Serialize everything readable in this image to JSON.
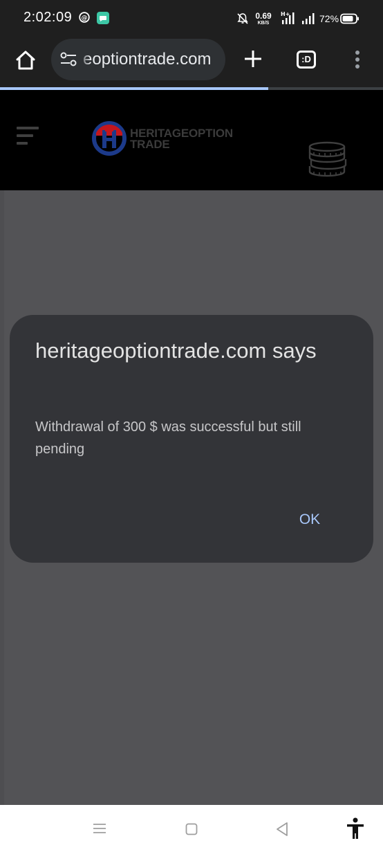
{
  "status_bar": {
    "time": "2:02:09",
    "net_speed_value": "0.69",
    "net_speed_unit": "KB/S",
    "network_type": "H+",
    "battery_percent": "72%",
    "icons": [
      "threads-icon",
      "app-notification-icon",
      "mute-bell-icon",
      "signal-icon",
      "signal-icon",
      "battery-icon"
    ]
  },
  "browser": {
    "url": "heritageoptiontrade.com",
    "url_visible_text": "eoptiontrade.com",
    "tab_switcher_label": ":D",
    "load_progress": 0.7,
    "icons": [
      "home-icon",
      "site-settings-icon",
      "plus-icon",
      "tab-switcher-icon",
      "overflow-menu-icon"
    ]
  },
  "site": {
    "logo_line1": "HERITAGEOPTION",
    "logo_line2": "TRADE",
    "logo_letters": "H",
    "icons": [
      "hamburger-menu-icon",
      "coins-stack-icon"
    ]
  },
  "dialog": {
    "title": "heritageoptiontrade.com says",
    "message": "Withdrawal of 300 $ was successful but still pending",
    "ok_label": "OK"
  },
  "nav_bar": {
    "icons": [
      "recents-icon",
      "home-square-icon",
      "back-triangle-icon",
      "accessibility-icon"
    ]
  },
  "colors": {
    "chrome_bg": "#1f1f1f",
    "url_pill_bg": "#2e3134",
    "progress": "#a8c7fa",
    "scrim": "#535356",
    "dialog_bg": "#333438",
    "dialog_button": "#a8c7fa",
    "logo_red": "#c4161c",
    "logo_blue": "#1c3a8a"
  }
}
